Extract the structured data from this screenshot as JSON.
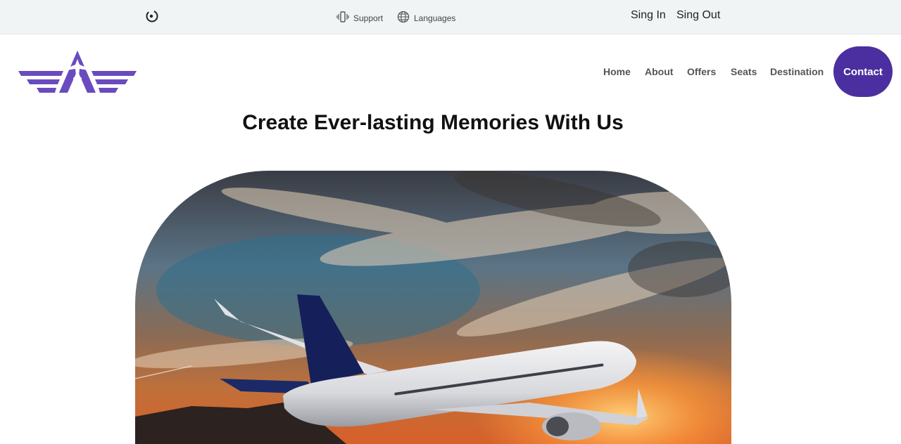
{
  "topbar": {
    "support_label": "Support",
    "languages_label": "Languages",
    "sign_in_label": "Sing In",
    "sign_out_label": "Sing Out"
  },
  "nav": {
    "items": [
      "Home",
      "About",
      "Offers",
      "Seats",
      "Destination"
    ],
    "contact_label": "Contact"
  },
  "hero": {
    "title": "Create Ever-lasting Memories With Us"
  },
  "colors": {
    "brand": "#6a4bbf",
    "contact_bg": "#4b2fa0",
    "topbar_bg": "#f0f4f4"
  },
  "icons": {
    "brand_mini": "spinner-icon",
    "support": "vibrate-phone-icon",
    "languages": "globe-icon",
    "logo": "wings-plane-logo"
  }
}
